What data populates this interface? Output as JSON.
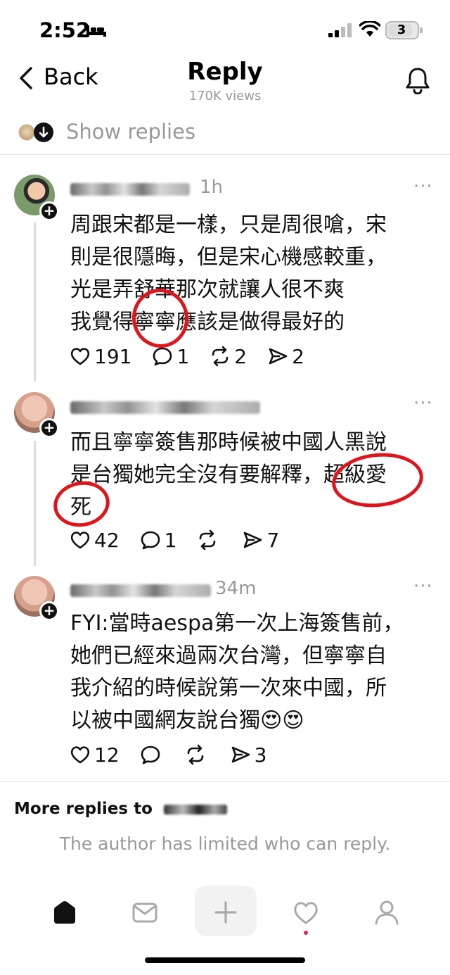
{
  "status_bar": {
    "time": "2:52",
    "battery": "3"
  },
  "header": {
    "back_label": "Back",
    "title": "Reply",
    "views": "170K views"
  },
  "show_replies": {
    "label": "Show replies"
  },
  "posts": [
    {
      "time": "1h",
      "lines": [
        "周跟宋都是一樣，只是周很嗆，宋",
        "則是很隱晦，但是宋心機感較重，",
        "光是弄舒華那次就讓人很不爽",
        "我覺得寧寧應該是做得最好的"
      ],
      "likes": "191",
      "comments": "1",
      "reposts": "2",
      "shares": "2"
    },
    {
      "time": "",
      "lines": [
        "而且寧寧簽售那時候被中國人黑說",
        "是台獨她完全沒有要解釋，超級愛",
        "死"
      ],
      "likes": "42",
      "comments": "1",
      "reposts": "",
      "shares": "7"
    },
    {
      "time": "34m",
      "lines": [
        "FYI:當時aespa第一次上海簽售前，",
        "她們已經來過兩次台灣，但寧寧自",
        "我介紹的時候說第一次來中國，所",
        "以被中國網友說台獨😍😍"
      ],
      "likes": "12",
      "comments": "",
      "reposts": "",
      "shares": "3"
    }
  ],
  "more_replies": {
    "label": "More replies to"
  },
  "limited_notice": "The author has limited who can reply.",
  "nav": [
    "home-icon",
    "inbox-icon",
    "compose-plus-icon",
    "activity-heart-icon",
    "profile-icon"
  ],
  "colors": {
    "muted": "#999999",
    "accent_mark": "#e2141b",
    "notification_dot": "#e0245e"
  }
}
